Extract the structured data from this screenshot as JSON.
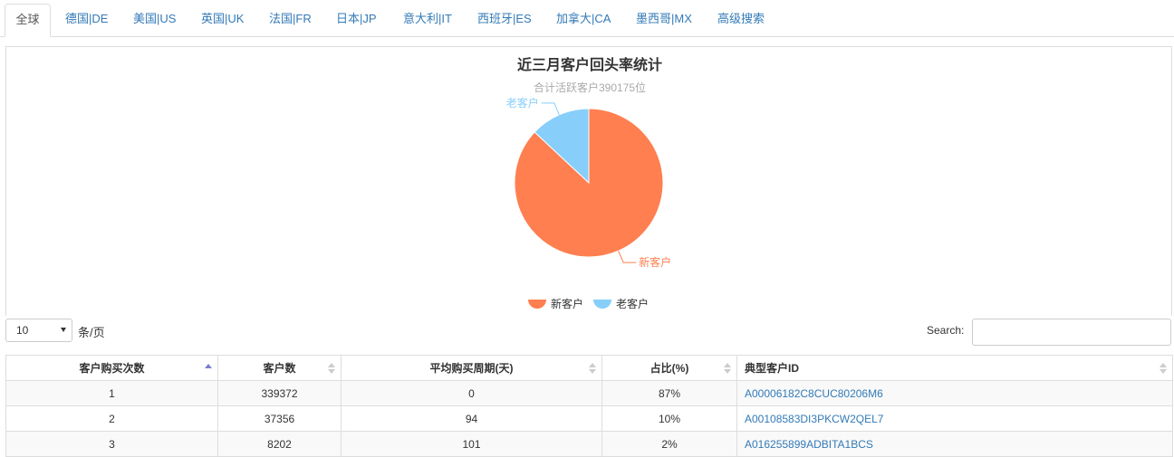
{
  "tabs": [
    {
      "label": "全球",
      "active": true
    },
    {
      "label": "德国|DE",
      "active": false
    },
    {
      "label": "美国|US",
      "active": false
    },
    {
      "label": "英国|UK",
      "active": false
    },
    {
      "label": "法国|FR",
      "active": false
    },
    {
      "label": "日本|JP",
      "active": false
    },
    {
      "label": "意大利|IT",
      "active": false
    },
    {
      "label": "西班牙|ES",
      "active": false
    },
    {
      "label": "加拿大|CA",
      "active": false
    },
    {
      "label": "墨西哥|MX",
      "active": false
    },
    {
      "label": "高级搜索",
      "active": false
    }
  ],
  "chart_data": {
    "type": "pie",
    "title": "近三月客户回头率统计",
    "subtitle": "合计活跃客户390175位",
    "categories": [
      "新客户",
      "老客户"
    ],
    "values": [
      339372,
      50803
    ],
    "colors": [
      "#ff7f50",
      "#87cefa"
    ],
    "legend": [
      "新客户",
      "老客户"
    ],
    "legend_position": "bottom-center"
  },
  "controls": {
    "page_length_value": "10",
    "page_length_suffix": "条/页",
    "search_label": "Search:",
    "search_value": ""
  },
  "table": {
    "columns": [
      "客户购买次数",
      "客户数",
      "平均购买周期(天)",
      "占比(%)",
      "典型客户ID"
    ],
    "sorted_column": 0,
    "sort_direction": "asc",
    "rows": [
      [
        "1",
        "339372",
        "0",
        "87%",
        "A00006182C8CUC80206M6"
      ],
      [
        "2",
        "37356",
        "94",
        "10%",
        "A00108583DI3PKCW2QEL7"
      ],
      [
        "3",
        "8202",
        "101",
        "2%",
        "A016255899ADBITA1BCS"
      ]
    ]
  }
}
